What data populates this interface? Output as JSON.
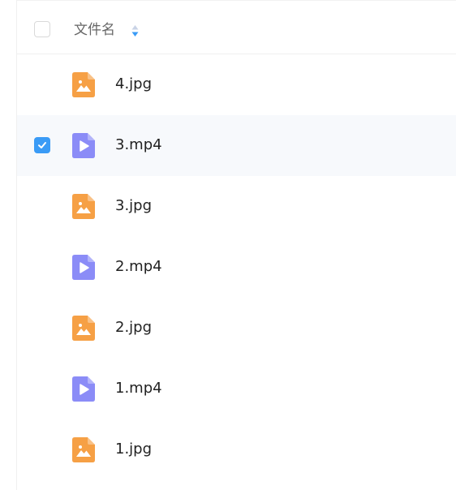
{
  "header": {
    "column_label": "文件名"
  },
  "files": [
    {
      "name": "4.jpg",
      "type": "image",
      "selected": false
    },
    {
      "name": "3.mp4",
      "type": "video",
      "selected": true
    },
    {
      "name": "3.jpg",
      "type": "image",
      "selected": false
    },
    {
      "name": "2.mp4",
      "type": "video",
      "selected": false
    },
    {
      "name": "2.jpg",
      "type": "image",
      "selected": false
    },
    {
      "name": "1.mp4",
      "type": "video",
      "selected": false
    },
    {
      "name": "1.jpg",
      "type": "image",
      "selected": false
    }
  ],
  "colors": {
    "image_icon": "#f6a045",
    "video_icon": "#8b8cf7",
    "checkbox_checked": "#3a9bf6",
    "selected_row": "#f7f9fc"
  }
}
